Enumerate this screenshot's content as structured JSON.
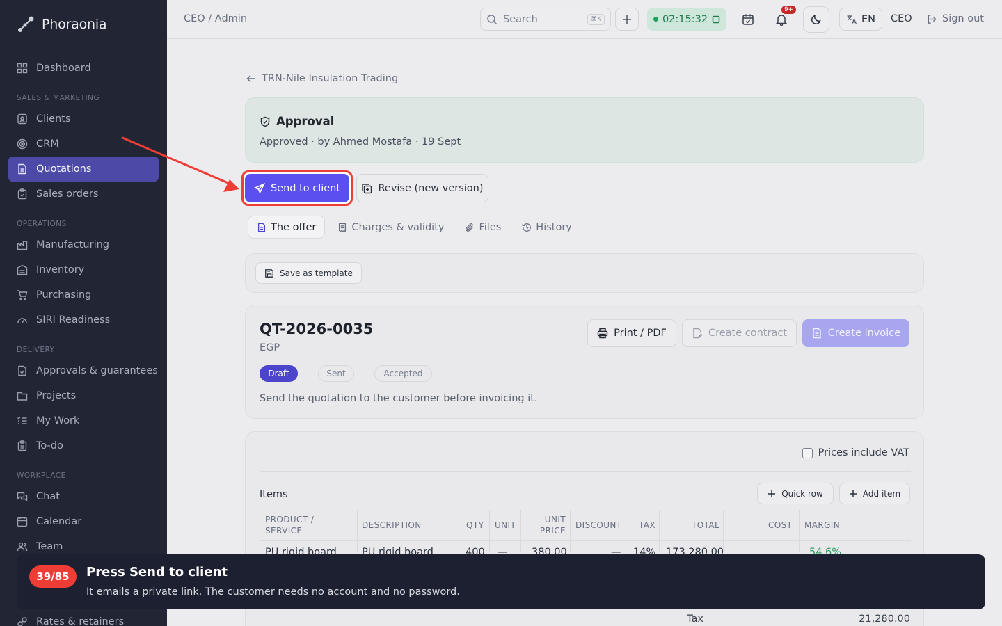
{
  "app": {
    "name": "Phoraonia"
  },
  "sidebar": {
    "top_items": [
      {
        "label": "Dashboard",
        "icon": "grid-icon"
      }
    ],
    "sections": [
      {
        "title": "SALES & MARKETING",
        "items": [
          {
            "label": "Clients",
            "icon": "id-card-icon"
          },
          {
            "label": "CRM",
            "icon": "target-icon"
          },
          {
            "label": "Quotations",
            "icon": "document-icon",
            "active": true
          },
          {
            "label": "Sales orders",
            "icon": "clipboard-icon"
          }
        ]
      },
      {
        "title": "OPERATIONS",
        "items": [
          {
            "label": "Manufacturing",
            "icon": "factory-icon"
          },
          {
            "label": "Inventory",
            "icon": "warehouse-icon"
          },
          {
            "label": "Purchasing",
            "icon": "cart-icon"
          },
          {
            "label": "SIRI Readiness",
            "icon": "gauge-icon"
          }
        ]
      },
      {
        "title": "DELIVERY",
        "items": [
          {
            "label": "Approvals & guarantees",
            "icon": "file-check-icon"
          },
          {
            "label": "Projects",
            "icon": "folder-icon"
          },
          {
            "label": "My Work",
            "icon": "list-check-icon"
          },
          {
            "label": "To-do",
            "icon": "clipboard-list-icon"
          }
        ]
      },
      {
        "title": "WORKPLACE",
        "items": [
          {
            "label": "Chat",
            "icon": "chat-icon"
          },
          {
            "label": "Calendar",
            "icon": "calendar-icon"
          },
          {
            "label": "Team",
            "icon": "users-icon"
          },
          {
            "label": "Rates & retainers",
            "icon": "link-icon"
          }
        ]
      }
    ]
  },
  "topbar": {
    "breadcrumb": "CEO / Admin",
    "search_placeholder": "Search",
    "search_shortcut": "⌘K",
    "timer": "02:15:32",
    "notifications_badge": "9+",
    "language": "EN",
    "role": "CEO",
    "signout": "Sign out"
  },
  "page": {
    "back_label": "TRN-Nile Insulation Trading",
    "approval_title": "Approval",
    "approval_sub": "Approved · by Ahmed Mostafa · 19 Sept",
    "send_label": "Send to client",
    "revise_label": "Revise (new version)",
    "tabs": [
      "The offer",
      "Charges & validity",
      "Files",
      "History"
    ],
    "save_template": "Save as template",
    "quote_number": "QT-2026-0035",
    "currency": "EGP",
    "print_label": "Print / PDF",
    "contract_label": "Create contract",
    "invoice_label": "Create invoice",
    "statuses": [
      "Draft",
      "Sent",
      "Accepted"
    ],
    "status_hint": "Send the quotation to the customer before invoicing it.",
    "vat_label": "Prices include VAT",
    "items_title": "Items",
    "quick_row": "Quick row",
    "add_item": "Add item",
    "columns": [
      "PRODUCT / SERVICE",
      "DESCRIPTION",
      "QTY",
      "UNIT",
      "UNIT PRICE",
      "DISCOUNT",
      "TAX",
      "TOTAL",
      "COST",
      "MARGIN"
    ],
    "row": [
      "PU rigid board",
      "PU rigid board",
      "400",
      "—",
      "380.00",
      "—",
      "14%",
      "173,280.00",
      "",
      "54.6%"
    ],
    "tax_label": "Tax",
    "tax_value": "21,280.00"
  },
  "tour": {
    "step": "39/85",
    "title": "Press Send to client",
    "body": "It emails a private link. The customer needs no account and no password."
  },
  "colors": {
    "accent": "#5b4ff0",
    "highlight": "#ef3d36",
    "sidebar": "#222634"
  }
}
